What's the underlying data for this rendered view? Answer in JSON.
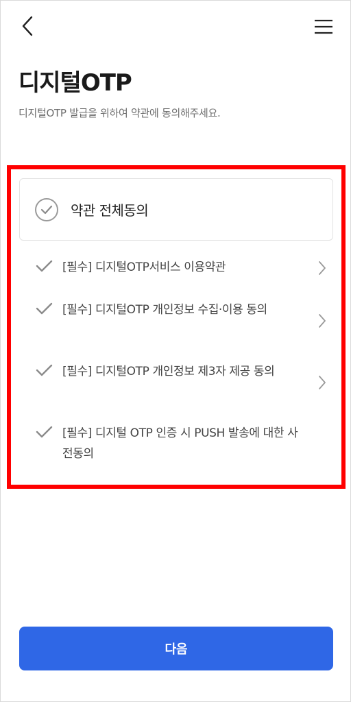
{
  "header": {
    "back_icon": "chevron-left-icon",
    "menu_icon": "hamburger-menu-icon"
  },
  "page": {
    "title": "디지털OTP",
    "description": "디지털OTP 발급을 위하여 약관에 동의해주세요."
  },
  "agreement": {
    "all_label": "약관 전체동의",
    "items": [
      {
        "label": "[필수] 디지털OTP서비스 이용약관",
        "has_detail": true
      },
      {
        "label": "[필수] 디지털OTP 개인정보 수집·이용 동의",
        "has_detail": true
      },
      {
        "label": "[필수] 디지털OTP 개인정보 제3자 제공 동의",
        "has_detail": true
      },
      {
        "label": "[필수] 디지털 OTP 인증 시 PUSH 발송에 대한 사전동의",
        "has_detail": false
      }
    ]
  },
  "footer": {
    "next_label": "다음"
  },
  "colors": {
    "primary": "#2f67e6",
    "highlight": "#ff0000",
    "check": "#8a8a8a"
  }
}
